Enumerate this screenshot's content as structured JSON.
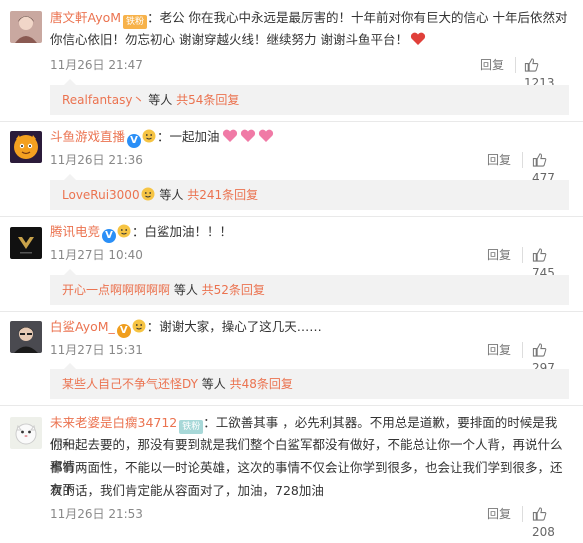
{
  "comments": [
    {
      "username": "唐文軒AyoM",
      "badge": "铁粉",
      "text": "：老公 你在我心中永远是最厉害的！十年前对你有巨大的信心 十年后依然对你信心依旧！勿忘初心 谢谢穿越火线！继续努力 谢谢斗鱼平台！",
      "time": "11月26日 21:47",
      "reply_label": "回复",
      "likes": "1213",
      "sub_user": "Realfantasy丶",
      "sub_mid": " 等人 ",
      "sub_more": "共54条回复"
    },
    {
      "username": "斗鱼游戏直播",
      "badge": "V",
      "text": "：一起加油",
      "time": "11月26日 21:36",
      "reply_label": "回复",
      "likes": "477",
      "sub_user": "LoveRui3000",
      "sub_mid": " 等人 ",
      "sub_more": "共241条回复"
    },
    {
      "username": "腾讯电竞",
      "badge": "V",
      "text": "：白鲨加油！！！",
      "time": "11月27日 10:40",
      "reply_label": "回复",
      "likes": "745",
      "sub_user": "开心一点啊啊啊啊啊",
      "sub_mid": " 等人 ",
      "sub_more": "共52条回复"
    },
    {
      "username": "白鲨AyoM_",
      "badge": "V",
      "text": "：谢谢大家，操心了这几天……",
      "time": "11月27日 15:31",
      "reply_label": "回复",
      "likes": "297",
      "sub_user": "某些人自己不争气还怪DY",
      "sub_mid": " 等人 ",
      "sub_more": "共48条回复"
    },
    {
      "username": "未来老婆是白瘸34712",
      "badge": "铁粉",
      "text_lines": [
        "：工欲善其事 ，必先利其器。不用总是道歉，要排面的时候是我们和",
        "你一起去要的，那没有要到就是我们整个白鲨军都没有做好，不能总让你一个人背，再说什么事情",
        "都有两面性，不能以一时论英雄，这次的事情不仅会让你学到很多，也会让我们学到很多，还有下",
        "次的话，我们肯定能从容面对了，加油，728加油"
      ],
      "time": "11月26日 21:53",
      "reply_label": "回复",
      "likes": "208"
    }
  ],
  "colors": {
    "username": "#eb7350",
    "sub_bg": "#f2f2f2",
    "meta": "#888888"
  }
}
